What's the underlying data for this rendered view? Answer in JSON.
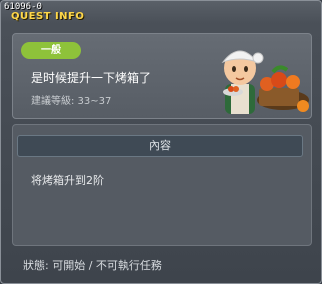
{
  "window": {
    "quest_id": "61096-0",
    "title": "QUEST INFO"
  },
  "header": {
    "badge": "一般",
    "quest_name": "是时候提升一下烤箱了",
    "level_text": "建議等級: 33~37"
  },
  "content": {
    "header": "內容",
    "text": "将烤箱升到2阶"
  },
  "status": "狀態: 可開始 / 不可執行任務",
  "colors": {
    "accent": "#ffd84a",
    "badge": "#8ec23a"
  }
}
